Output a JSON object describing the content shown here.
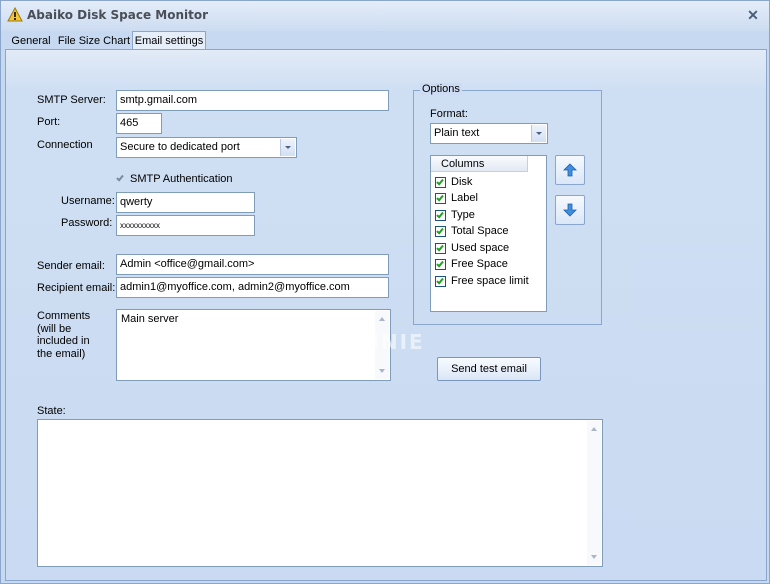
{
  "window": {
    "title": "Abaiko Disk Space Monitor"
  },
  "tabs": [
    {
      "label": "General"
    },
    {
      "label": "File Size Chart"
    },
    {
      "label": "Email settings"
    }
  ],
  "smtp": {
    "server_label": "SMTP Server:",
    "server_value": "smtp.gmail.com",
    "port_label": "Port:",
    "port_value": "465",
    "connection_label": "Connection",
    "connection_value": "Secure to dedicated port",
    "auth_label": "SMTP Authentication",
    "auth_checked": true,
    "username_label": "Username:",
    "username_value": "qwerty",
    "password_label": "Password:",
    "password_value": "xxxxxxxxxx"
  },
  "email": {
    "sender_label": "Sender email:",
    "sender_value": "Admin <office@gmail.com>",
    "recipient_label": "Recipient email:",
    "recipient_value": "admin1@myoffice.com, admin2@myoffice.com",
    "comments_label_1": "Comments",
    "comments_label_2": "(will be",
    "comments_label_3": "included in",
    "comments_label_4": "the email)",
    "comments_value": "Main server",
    "state_label": "State:"
  },
  "options": {
    "group_title": "Options",
    "format_label": "Format:",
    "format_value": "Plain text",
    "columns_header": "Columns",
    "columns": [
      {
        "label": "Disk",
        "checked": true
      },
      {
        "label": "Label",
        "checked": true
      },
      {
        "label": "Type",
        "checked": true
      },
      {
        "label": "Total Space",
        "checked": true
      },
      {
        "label": "Used space",
        "checked": true
      },
      {
        "label": "Free Space",
        "checked": true
      },
      {
        "label": "Free space limit",
        "checked": true
      }
    ]
  },
  "buttons": {
    "send_test": "Send test email"
  },
  "watermark": "OLECHNIE"
}
